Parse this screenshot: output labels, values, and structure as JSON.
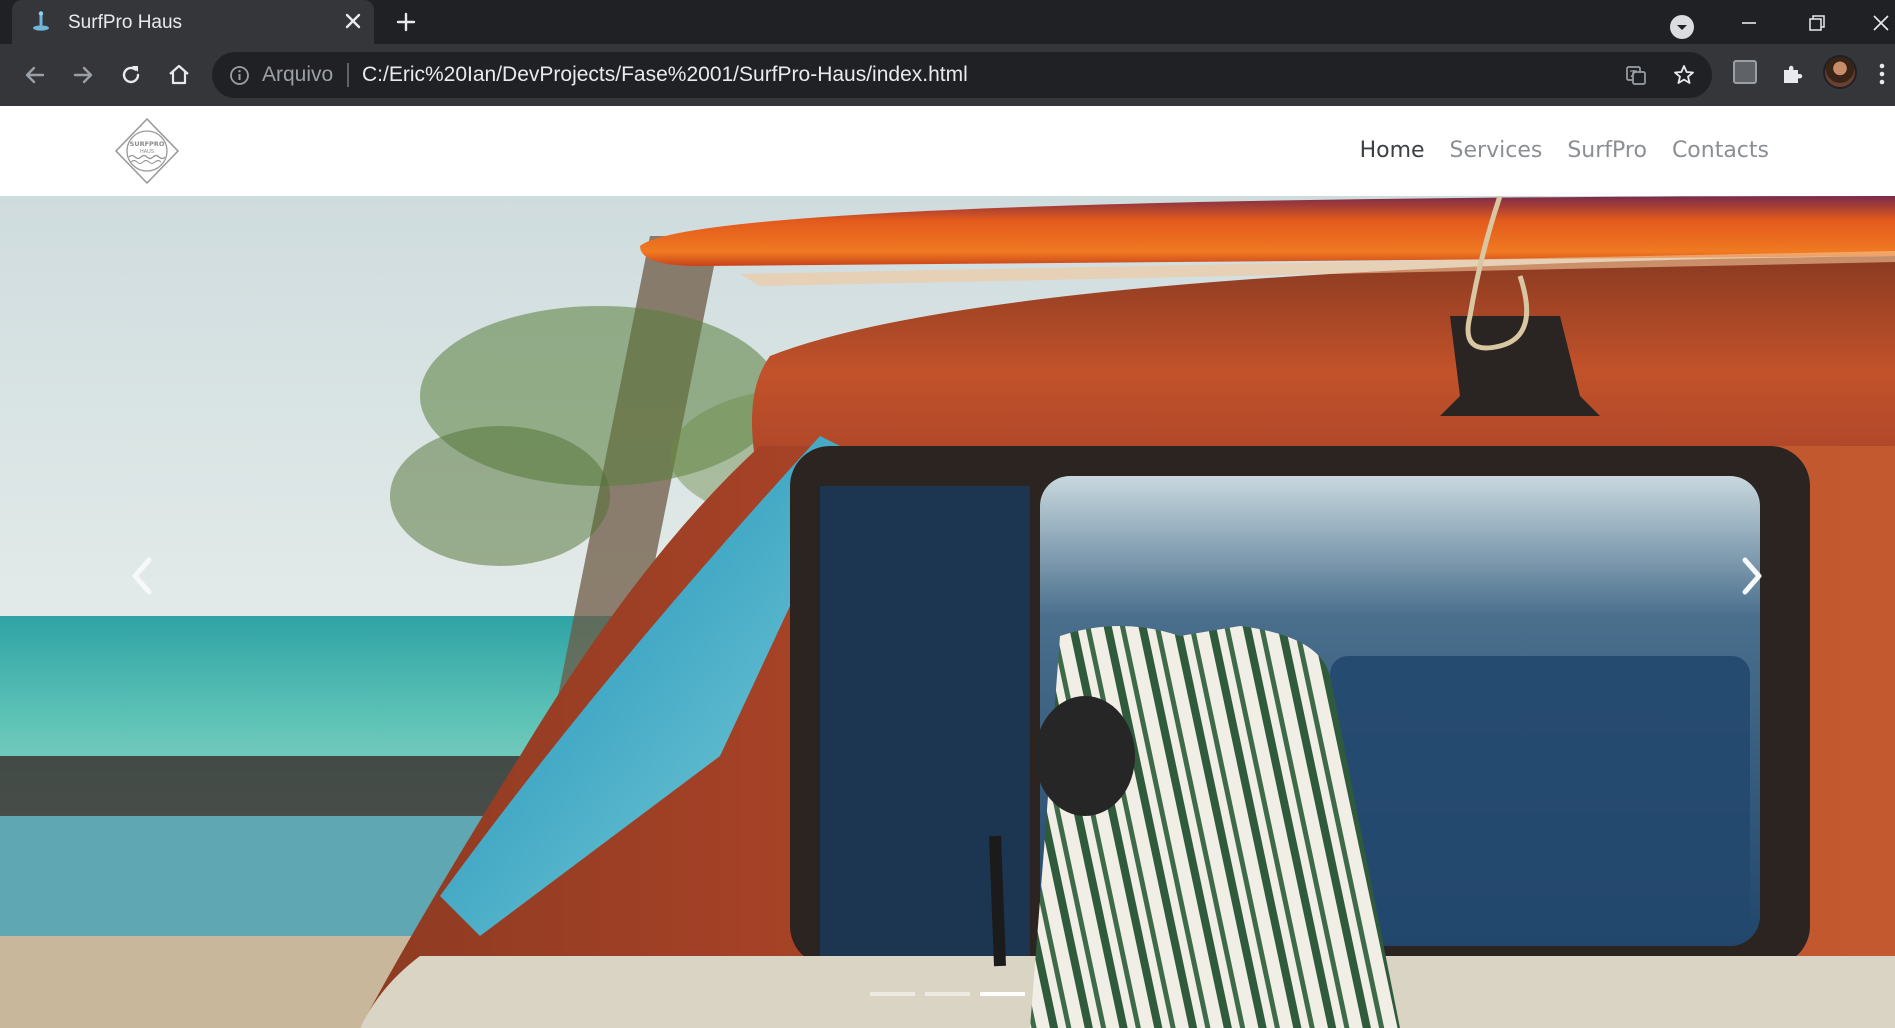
{
  "browser": {
    "tab": {
      "title": "SurfPro Haus"
    },
    "omnibox": {
      "origin_label": "Arquivo",
      "url": "C:/Eric%20Ian/DevProjects/Fase%2001/SurfPro-Haus/index.html"
    },
    "theme": {
      "frame": "#202124",
      "toolbar": "#35363a",
      "text": "#e8eaed"
    }
  },
  "site": {
    "logo": {
      "text_top": "SURFPRO",
      "text_bottom": "HAUS"
    },
    "nav": {
      "items": [
        {
          "label": "Home",
          "active": true
        },
        {
          "label": "Services",
          "active": false
        },
        {
          "label": "SurfPro",
          "active": false
        },
        {
          "label": "Contacts",
          "active": false
        }
      ]
    },
    "carousel": {
      "slide_count": 3,
      "active_slide": 3,
      "prev_icon": "chevron-left-icon",
      "next_icon": "chevron-right-icon"
    },
    "colors": {
      "nav_active": "#3d4043",
      "nav_inactive": "#8b8f94",
      "van": "#b8441f",
      "surfboard": "#e8561d",
      "sea": "#46b3b0"
    }
  }
}
